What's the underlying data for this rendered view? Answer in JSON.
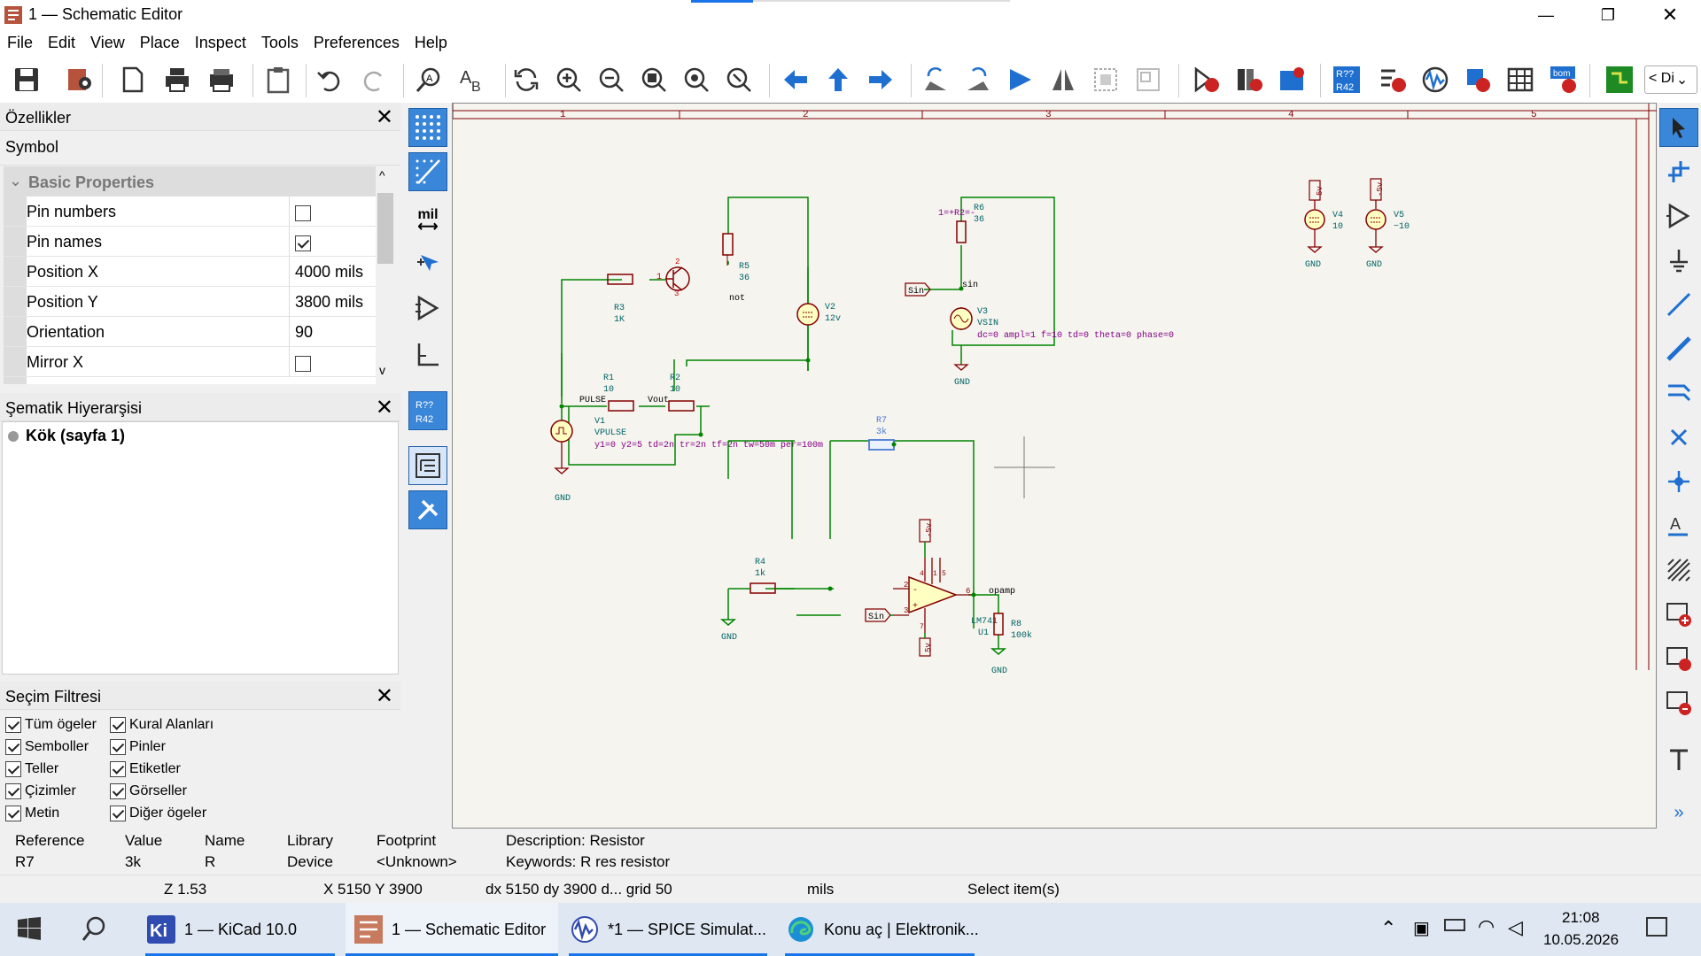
{
  "window": {
    "title": "1 — Schematic Editor",
    "minimize": "—",
    "restore": "❐",
    "close": "✕"
  },
  "menu": [
    "File",
    "Edit",
    "View",
    "Place",
    "Inspect",
    "Tools",
    "Preferences",
    "Help"
  ],
  "toolbar": {
    "overflow": "< Di"
  },
  "properties": {
    "title": "Özellikler",
    "close": "✕",
    "type": "Symbol",
    "section": "Basic Properties",
    "rows": [
      {
        "key": "Pin numbers",
        "value": ""
      },
      {
        "key": "Pin names",
        "value": ""
      },
      {
        "key": "Position X",
        "value": "4000 mils"
      },
      {
        "key": "Position Y",
        "value": "3800 mils"
      },
      {
        "key": "Orientation",
        "value": "90"
      },
      {
        "key": "Mirror X",
        "value": ""
      }
    ],
    "checks": {
      "pin_numbers": false,
      "pin_names": true,
      "mirror_x": false
    }
  },
  "hierarchy": {
    "title": "Şematik Hiyerarşisi",
    "close": "✕",
    "root": "Kök (sayfa 1)"
  },
  "filter": {
    "title": "Seçim Filtresi",
    "close": "✕",
    "items": [
      "Tüm ögeler",
      "Semboller",
      "Teller",
      "Çizimler",
      "Metin",
      "Kural Alanları",
      "Pinler",
      "Etiketler",
      "Görseller",
      "Diğer ögeler"
    ]
  },
  "lefttools": {
    "units": "mil"
  },
  "schematic": {
    "columns": [
      "1",
      "2",
      "3",
      "4",
      "5"
    ],
    "labels": {
      "r5_ref": "R5",
      "r5_val": "36",
      "not": "not",
      "v2_ref": "V2",
      "v2_val": "12v",
      "r3_ref": "R3",
      "r3_val": "1K",
      "q_pin1": "1",
      "q_pin2": "2",
      "q_pin3": "3",
      "r1_ref": "R1",
      "r1_val": "10",
      "r2_ref": "R2",
      "r2_val": "10",
      "pulse": "PULSE",
      "vout": "Vout",
      "v1_ref": "V1",
      "v1_val": "VPULSE",
      "v1_param": "y1=0 y2=5 td=2n tr=2n tf=2n tw=50m per=100m",
      "gnd": "GND",
      "r6_ref": "R6",
      "r6_val": "36",
      "r6_pins": "1=+R2=-",
      "sin_flag": "Sin",
      "sin_net": "sin",
      "v3_ref": "V3",
      "v3_val": "VSIN",
      "v3_param": "dc=0 ampl=1 f=10 td=0 theta=0 phase=0",
      "v4_ref": "V4",
      "v4_val": "10",
      "v5_ref": "V5",
      "v5_val": "−10",
      "p5v": "5v",
      "n5v": "-5v",
      "r7_ref": "R7",
      "r7_val": "3k",
      "r4_ref": "R4",
      "r4_val": "1k",
      "opamp": "opamp",
      "u1_val": "LM741",
      "u1_ref": "U1",
      "r8_ref": "R8",
      "r8_val": "100k",
      "pin2": "2",
      "pin3": "3",
      "pin6": "6",
      "pin4": "4",
      "pin7": "7",
      "pin1": "1",
      "pin5": "5"
    }
  },
  "message": {
    "headers": [
      "Reference",
      "Value",
      "Name",
      "Library",
      "Footprint",
      "Description: Resistor"
    ],
    "values": [
      "R7",
      "3k",
      "R",
      "Device",
      "<Unknown>",
      "Keywords: R res resistor"
    ]
  },
  "status": {
    "zoom": "Z 1.53",
    "coords": "X 5150  Y 3900",
    "delta": "dx 5150  dy 3900  d...  grid 50",
    "units": "mils",
    "mode": "Select item(s)"
  },
  "taskbar": {
    "apps": [
      "1 — KiCad 10.0",
      "1 — Schematic Editor",
      "*1 — SPICE Simulat...",
      "Konu aç | Elektronik..."
    ],
    "time": "21:08",
    "date": "10.05.2026"
  },
  "colors": {
    "wire": "#008400",
    "symbol": "#840000",
    "field": "#006464",
    "param": "#840084",
    "source": "#ffffc2",
    "accent": "#1a73e8"
  }
}
